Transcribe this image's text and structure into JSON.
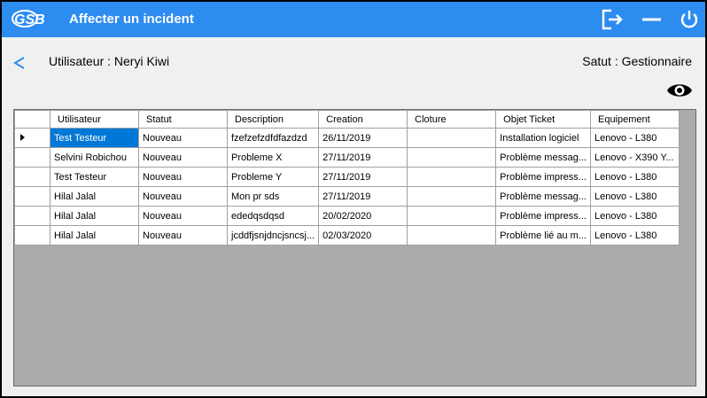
{
  "titlebar": {
    "logo_text": "GSB",
    "title": "Affecter un incident",
    "buttons": [
      "logout-icon",
      "minimize-icon",
      "power-icon"
    ],
    "color": "#2d8cf0"
  },
  "header": {
    "back_label": "<",
    "user_text": "Utilisateur : Neryi Kiwi",
    "status_text": "Satut : Gestionnaire"
  },
  "grid": {
    "columns": [
      "Utilisateur",
      "Statut",
      "Description",
      "Creation",
      "Cloture",
      "Objet Ticket",
      "Equipement"
    ],
    "rows": [
      [
        "Test Testeur",
        "Nouveau",
        "fzefzefzdfdfazdzd",
        "26/11/2019",
        "",
        "Installation logiciel",
        "Lenovo - L380"
      ],
      [
        "Selvini Robichou",
        "Nouveau",
        "Probleme X",
        "27/11/2019",
        "",
        "Problème messag...",
        "Lenovo - X390 Y..."
      ],
      [
        "Test Testeur",
        "Nouveau",
        "Probleme Y",
        "27/11/2019",
        "",
        "Problème impress...",
        "Lenovo - L380"
      ],
      [
        "Hilal Jalal",
        "Nouveau",
        "Mon pr sds",
        "27/11/2019",
        "",
        "Problème messag...",
        "Lenovo - L380"
      ],
      [
        "Hilal Jalal",
        "Nouveau",
        "ededqsdqsd",
        "20/02/2020",
        "",
        "Problème impress...",
        "Lenovo - L380"
      ],
      [
        "Hilal Jalal",
        "Nouveau",
        "jcddfjsnjdncjsncsj...",
        "02/03/2020",
        "",
        "Problème lié au m...",
        "Lenovo - L380"
      ]
    ],
    "selected_row": 0,
    "selection_color": "#0078d7"
  }
}
